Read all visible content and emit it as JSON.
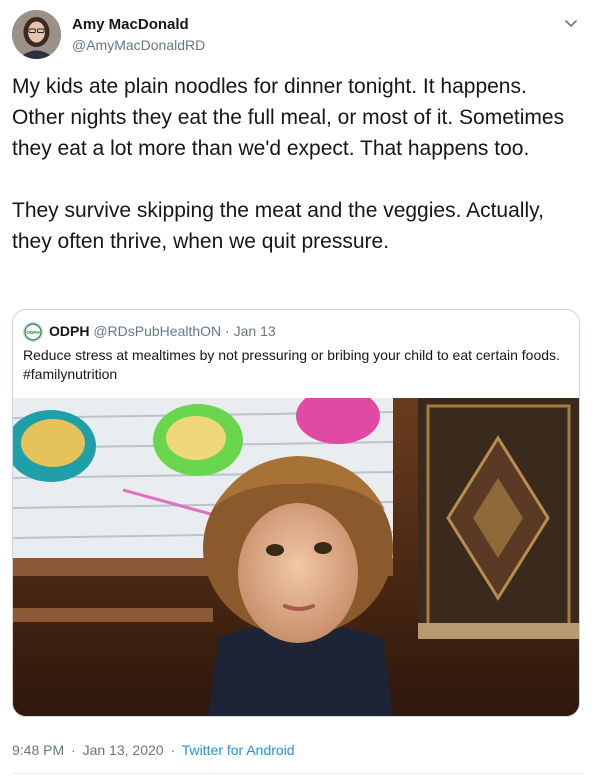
{
  "author": {
    "name": "Amy MacDonald",
    "handle": "@AmyMacDonaldRD"
  },
  "tweet_text": "My kids ate plain noodles for dinner tonight. It happens. Other nights they eat the full meal, or most of it. Sometimes they eat a lot more than we'd expect. That happens too.\n\nThey survive skipping the meat and the veggies. Actually, they often thrive, when we quit pressure.",
  "quoted_tweet": {
    "avatar_text": "ODPH",
    "name": "ODPH",
    "handle": "@RDsPubHealthON",
    "separator": "·",
    "date": "Jan 13",
    "text": "Reduce stress at mealtimes by not pressuring or bribing your child to eat certain foods. #familynutrition"
  },
  "footer": {
    "time": "9:48 PM",
    "separator": "·",
    "date": "Jan 13, 2020",
    "source_separator": "·",
    "source": "Twitter for Android"
  },
  "icons": {
    "menu": "chevron-down-icon"
  },
  "colors": {
    "link": "#1b95e0",
    "secondary_text": "#657786",
    "border": "#ccd6dd"
  }
}
